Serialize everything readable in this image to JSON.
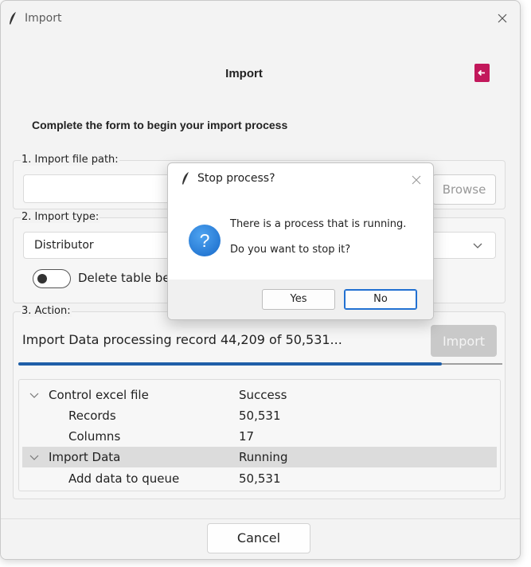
{
  "window": {
    "title": "Import",
    "icon": "feather-icon",
    "close_icon": "close-icon"
  },
  "page": {
    "title": "Import",
    "exit_icon": "exit-icon",
    "subtitle": "Complete the form to begin your import process"
  },
  "section1": {
    "label": "1. Import file path:",
    "path_value": "",
    "browse_label": "Browse"
  },
  "section2": {
    "label": "2. Import type:",
    "selected_type": "Distributor",
    "toggle_label": "Delete table be",
    "toggle_on": false
  },
  "section3": {
    "label": "3. Action:",
    "status_text": "Import Data processing record 44,209 of 50,531...",
    "import_label": "Import",
    "progress_fraction": 0.875
  },
  "tree": {
    "rows": [
      {
        "name": "Control excel file",
        "value": "Success",
        "expandable": true,
        "highlighted": false
      },
      {
        "name": "Records",
        "value": "50,531",
        "expandable": false,
        "highlighted": false
      },
      {
        "name": "Columns",
        "value": "17",
        "expandable": false,
        "highlighted": false
      },
      {
        "name": "Import Data",
        "value": "Running",
        "expandable": true,
        "highlighted": true
      },
      {
        "name": "Add data to queue",
        "value": "50,531",
        "expandable": false,
        "highlighted": false
      }
    ]
  },
  "footer": {
    "cancel_label": "Cancel"
  },
  "dialog": {
    "title": "Stop process?",
    "icon": "question-icon",
    "question_glyph": "?",
    "message_line1": "There is a process that is running.",
    "message_line2": "Do you want to stop it?",
    "yes_label": "Yes",
    "no_label": "No"
  },
  "colors": {
    "accent": "#1f5fa8",
    "exit_button": "#c2185b",
    "question_icon": "#1769c9"
  }
}
